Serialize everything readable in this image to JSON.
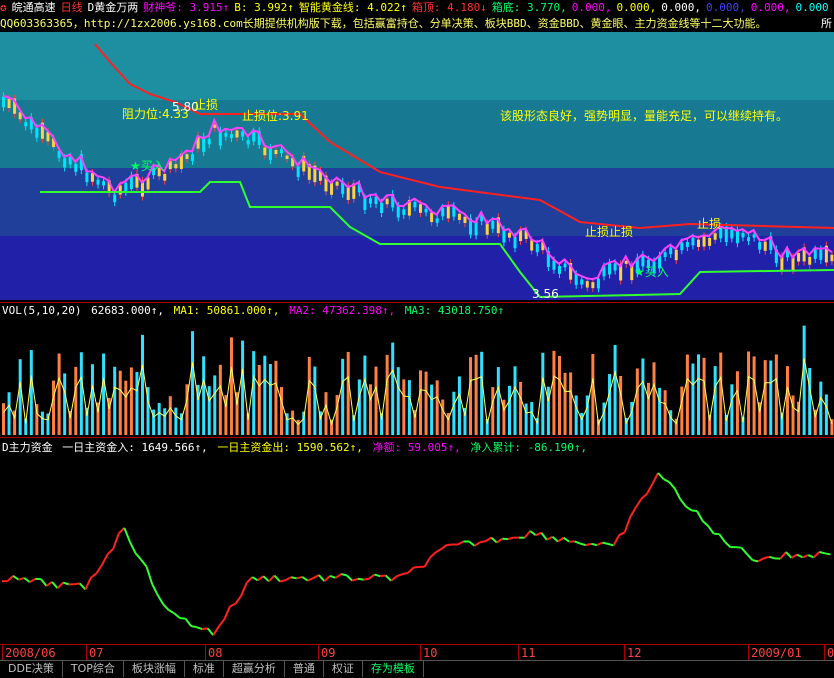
{
  "window": {
    "app_name": "皖通高速",
    "period": "日线",
    "indicator_name": "D黄金万两",
    "items": [
      {
        "label": "财神爷:",
        "value": "3.915↑",
        "color": "#ff00ff"
      },
      {
        "label": "B:",
        "value": "3.992↑",
        "color": "#ffff00"
      },
      {
        "label": "智能黄金线:",
        "value": "4.022↑",
        "color": "#ffff00"
      },
      {
        "label": "箱顶:",
        "value": "4.180↓",
        "color": "#ff3030"
      },
      {
        "label": "箱底:",
        "value": "3.770,",
        "color": "#00ff66"
      },
      {
        "label": "",
        "value": "0.000,",
        "color": "#ff00ff"
      },
      {
        "label": "",
        "value": "0.000,",
        "color": "#ffff00"
      },
      {
        "label": "",
        "value": "0.000,",
        "color": "#ffffff"
      },
      {
        "label": "",
        "value": "0.000,",
        "color": "#4040ff"
      },
      {
        "label": "",
        "value": "0.000,",
        "color": "#ff00ff"
      },
      {
        "label": "",
        "value": "0.000",
        "color": "#00ffff"
      }
    ]
  },
  "info_line": {
    "text": "QQ603363365，http://1zx2006.ys168.com长期提供机构版下载，包括赢富持仓、分单决策、板块BBD、资金BBD、黄金眼、主力资金线等十二大功能。",
    "right_label": "所"
  },
  "main_annotations": [
    {
      "text": "阻力位:4.33",
      "color": "#ffff00"
    },
    {
      "text": "5.80",
      "color": "#ffffff"
    },
    {
      "text": "止损",
      "color": "#ffff00"
    },
    {
      "text": "止损位:3.91",
      "color": "#ffff00"
    },
    {
      "text": "该股形态良好，强势明显，量能充足，可以继续持有。",
      "color": "#ffff00"
    },
    {
      "text": "★买入",
      "color": "#00ff66"
    },
    {
      "text": "止损止损",
      "color": "#ffff00"
    },
    {
      "text": "止损",
      "color": "#ffff00"
    },
    {
      "text": "★买入",
      "color": "#00ff66"
    },
    {
      "text": "3.56",
      "color": "#ffffff"
    }
  ],
  "vol_legend": {
    "name": "VOL(5,10,20)",
    "value": "62683.000↑,",
    "ma1": "MA1: 50861.000↑,",
    "ma2": "MA2: 47362.398↑,",
    "ma3": "MA3: 43018.750↑"
  },
  "fund_legend": {
    "name": "D主力资金",
    "in": "一日主资金入: 1649.566↑,",
    "out": "一日主资金出: 1590.562↑,",
    "net": "净额: 59.005↑,",
    "cum": "净入累计: -86.190↑,"
  },
  "axis": {
    "months": [
      "2008/06",
      "07",
      "08",
      "09",
      "10",
      "11",
      "12",
      "2009/01",
      "0"
    ]
  },
  "tabs": [
    {
      "label": "DDE决策",
      "active": false
    },
    {
      "label": "TOP综合",
      "active": false
    },
    {
      "label": "板块涨幅",
      "active": false
    },
    {
      "label": "标准",
      "active": false
    },
    {
      "label": "超赢分析",
      "active": false
    },
    {
      "label": "普通",
      "active": false
    },
    {
      "label": "权证",
      "active": false
    },
    {
      "label": "存为模板",
      "active": true
    }
  ]
}
